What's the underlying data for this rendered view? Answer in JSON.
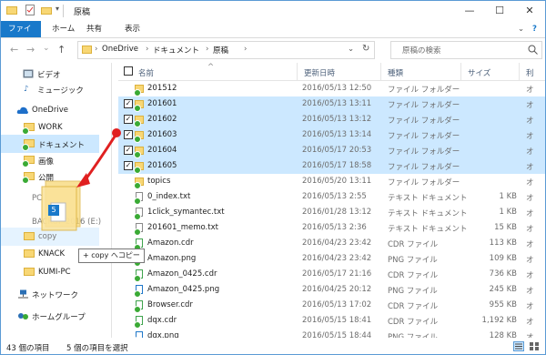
{
  "window": {
    "title": "原稿",
    "controls": {
      "minimize": "—",
      "maximize": "☐",
      "close": "✕"
    }
  },
  "ribbon": {
    "tabs": [
      "ファイル",
      "ホーム",
      "共有",
      "表示"
    ],
    "expand": "⌄",
    "help": "?"
  },
  "nav": {
    "back": "←",
    "forward": "→",
    "recent": "⌄",
    "up": "↑",
    "breadcrumb": [
      "OneDrive",
      "ドキュメント",
      "原稿"
    ],
    "sep": "›",
    "dropdown": "⌄",
    "refresh": "↻",
    "search_placeholder": "原稿の検索",
    "search_icon": "search-icon"
  },
  "navpane": [
    {
      "label": "ビデオ"
    },
    {
      "label": "ミュージック"
    },
    {
      "label": "OneDrive"
    },
    {
      "label": "WORK"
    },
    {
      "label": "ドキュメント"
    },
    {
      "label": "画像"
    },
    {
      "label": "公開"
    },
    {
      "label": "PC"
    },
    {
      "label": "BACKUP 2016 (E:)"
    },
    {
      "label": "copy"
    },
    {
      "label": "KNACK"
    },
    {
      "label": "KUMI-PC"
    },
    {
      "label": "ネットワーク"
    },
    {
      "label": "ホームグループ"
    }
  ],
  "columns": {
    "name": "名前",
    "date": "更新日時",
    "type": "種類",
    "size": "サイズ",
    "extra": "利"
  },
  "files": [
    {
      "name": "201512",
      "date": "2016/05/13 12:50",
      "type": "ファイル フォルダー",
      "size": "",
      "extra": "オ",
      "kind": "folder",
      "selected": false
    },
    {
      "name": "201601",
      "date": "2016/05/13 13:11",
      "type": "ファイル フォルダー",
      "size": "",
      "extra": "オ",
      "kind": "folder",
      "selected": true
    },
    {
      "name": "201602",
      "date": "2016/05/13 13:12",
      "type": "ファイル フォルダー",
      "size": "",
      "extra": "オ",
      "kind": "folder",
      "selected": true
    },
    {
      "name": "201603",
      "date": "2016/05/13 13:14",
      "type": "ファイル フォルダー",
      "size": "",
      "extra": "オ",
      "kind": "folder",
      "selected": true
    },
    {
      "name": "201604",
      "date": "2016/05/17 20:53",
      "type": "ファイル フォルダー",
      "size": "",
      "extra": "オ",
      "kind": "folder",
      "selected": true
    },
    {
      "name": "201605",
      "date": "2016/05/17 18:58",
      "type": "ファイル フォルダー",
      "size": "",
      "extra": "オ",
      "kind": "folder",
      "selected": true
    },
    {
      "name": "topics",
      "date": "2016/05/20 13:11",
      "type": "ファイル フォルダー",
      "size": "",
      "extra": "オ",
      "kind": "folder",
      "selected": false
    },
    {
      "name": "0_index.txt",
      "date": "2016/05/13 2:55",
      "type": "テキスト ドキュメント",
      "size": "1 KB",
      "extra": "オ",
      "kind": "file",
      "selected": false
    },
    {
      "name": "1click_symantec.txt",
      "date": "2016/01/28 13:12",
      "type": "テキスト ドキュメント",
      "size": "1 KB",
      "extra": "オ",
      "kind": "file",
      "selected": false
    },
    {
      "name": "201601_memo.txt",
      "date": "2016/05/13 2:36",
      "type": "テキスト ドキュメント",
      "size": "15 KB",
      "extra": "オ",
      "kind": "file",
      "selected": false
    },
    {
      "name": "Amazon.cdr",
      "date": "2016/04/23 23:42",
      "type": "CDR ファイル",
      "size": "113 KB",
      "extra": "オ",
      "kind": "cdr",
      "selected": false
    },
    {
      "name": "Amazon.png",
      "date": "2016/04/23 23:42",
      "type": "PNG ファイル",
      "size": "109 KB",
      "extra": "オ",
      "kind": "png",
      "selected": false
    },
    {
      "name": "Amazon_0425.cdr",
      "date": "2016/05/17 21:16",
      "type": "CDR ファイル",
      "size": "736 KB",
      "extra": "オ",
      "kind": "cdr",
      "selected": false
    },
    {
      "name": "Amazon_0425.png",
      "date": "2016/04/25 20:12",
      "type": "PNG ファイル",
      "size": "245 KB",
      "extra": "オ",
      "kind": "png",
      "selected": false
    },
    {
      "name": "Browser.cdr",
      "date": "2016/05/13 17:02",
      "type": "CDR ファイル",
      "size": "955 KB",
      "extra": "オ",
      "kind": "cdr",
      "selected": false
    },
    {
      "name": "dqx.cdr",
      "date": "2016/05/15 18:41",
      "type": "CDR ファイル",
      "size": "1,192 KB",
      "extra": "オ",
      "kind": "cdr",
      "selected": false
    },
    {
      "name": "dqx.png",
      "date": "2016/05/15 18:44",
      "type": "PNG ファイル",
      "size": "128 KB",
      "extra": "オ",
      "kind": "png",
      "selected": false
    }
  ],
  "status": {
    "count": "43 個の項目",
    "selected": "5 個の項目を選択"
  },
  "drag": {
    "badge": "5",
    "tooltip": "+ copy へコピー"
  },
  "colors": {
    "accent": "#1979ca",
    "selection": "#cce8ff",
    "arrow": "#e02020",
    "sync": "#3aaa35"
  }
}
